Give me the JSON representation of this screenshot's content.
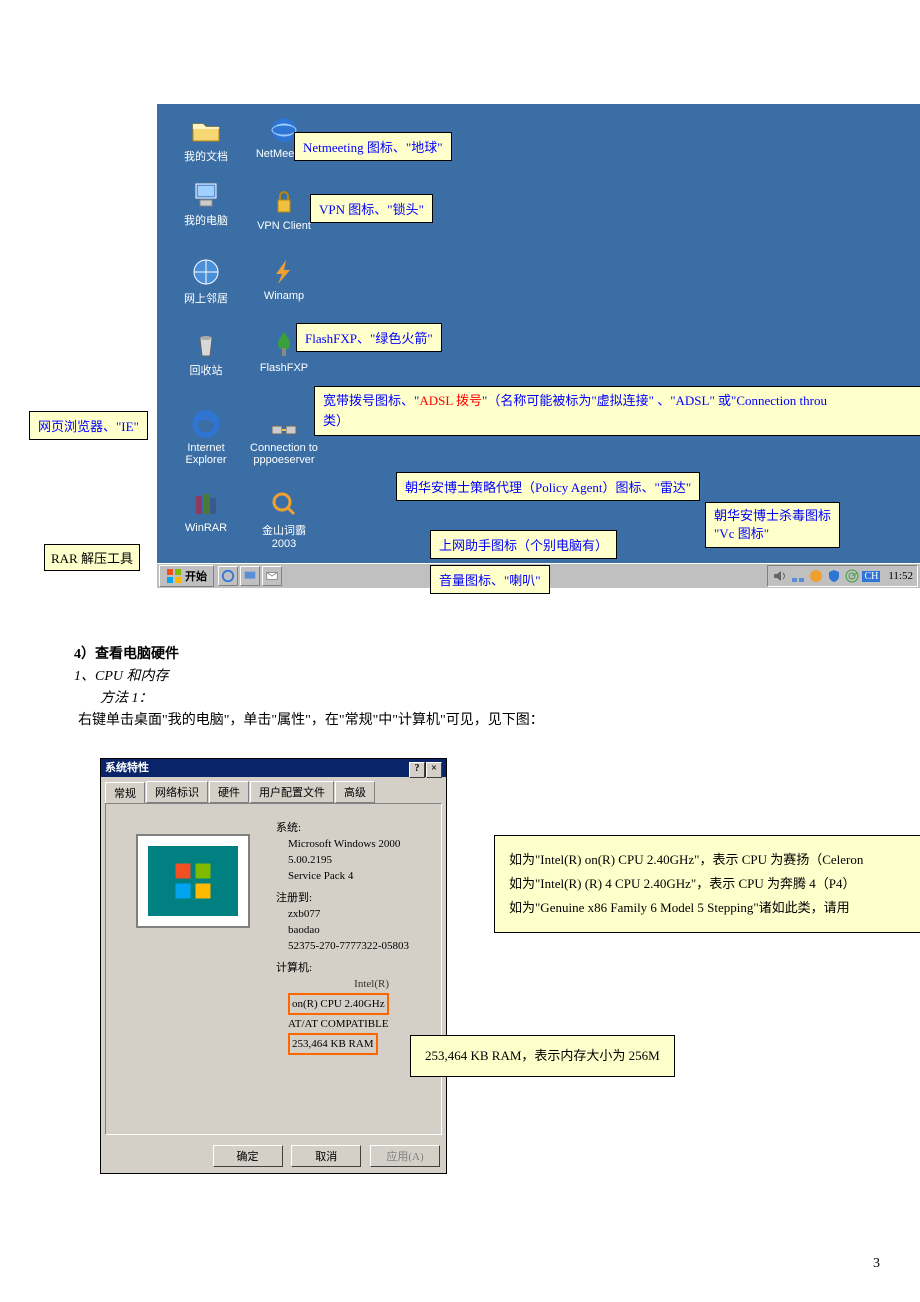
{
  "desktop": {
    "icons": {
      "mydoc": "我的文档",
      "netmeeting": "NetMeeting",
      "mycomputer": "我的电脑",
      "vpn": "VPN Client",
      "network": "网上邻居",
      "winamp": "Winamp",
      "recycle": "回收站",
      "flashfxp": "FlashFXP",
      "ie": "Internet Explorer",
      "pppoe": "Connection to pppoeserver",
      "winrar": "WinRAR",
      "jinshan": "金山词霸 2003"
    },
    "taskbar": {
      "start": "开始",
      "clock": "11:52",
      "lang": "CH"
    }
  },
  "callouts": {
    "netmeeting": "Netmeeting 图标、\"地球\"",
    "vpn": "VPN 图标、\"锁头\"",
    "flashfxp": "FlashFXP、\"绿色火箭\"",
    "ie": "网页浏览器、\"IE\"",
    "adsl_p1": "宽带拨号图标、\"",
    "adsl_red": "ADSL 拨号",
    "adsl_p2": "\"（名称可能被标为\"虚拟连接\" 、\"ADSL\" 或\"Connection throu",
    "adsl_p3": "类）",
    "rar": "RAR 解压工具",
    "policy": "朝华安博士策略代理（Policy Agent）图标、\"雷达\"",
    "vc_l1": "朝华安博士杀毒图标",
    "vc_l2": "\"Vc 图标\"",
    "helper": "上网助手图标（个别电脑有）",
    "volume": "音量图标、\"喇叭\""
  },
  "body": {
    "h4": "4）查看电脑硬件",
    "h_cpu": "1、CPU 和内存",
    "m1": "方法 1：",
    "m1_text": "右键单击桌面\"我的电脑\"，单击\"属性\"，在\"常规\"中\"计算机\"可见，见下图："
  },
  "dialog": {
    "title": "系统特性",
    "tabs": [
      "常规",
      "网络标识",
      "硬件",
      "用户配置文件",
      "高级"
    ],
    "system_label": "系统:",
    "system_lines": [
      "Microsoft Windows 2000",
      "5.00.2195",
      "Service Pack 4"
    ],
    "reg_label": "注册到:",
    "reg_lines": [
      "zxb077",
      "baodao",
      "52375-270-7777322-05803"
    ],
    "computer_label": "计算机:",
    "comp_lines": [
      "Intel(R)",
      "on(R) CPU 2.40GHz",
      "AT/AT COMPATIBLE",
      "253,464 KB RAM"
    ],
    "btn_ok": "确定",
    "btn_cancel": "取消",
    "btn_apply": "应用(A)"
  },
  "cpu_callout": {
    "l1a": "如为\"Intel(R) ",
    "l1r": "on",
    "l1b": "(R) CPU 2.40GHz\"，表示 CPU 为赛扬（Celeron",
    "l2a": "如为\"Intel(R)   (R) ",
    "l2r": "4",
    "l2b": " CPU 2.40GHz\"，表示 CPU 为奔腾 4（P4）",
    "l3": "如为\"Genuine x86 Family 6 Model 5 Stepping\"诸如此类，请用"
  },
  "ram_callout": "253,464 KB RAM，表示内存大小为 256M",
  "pagenum": "3"
}
